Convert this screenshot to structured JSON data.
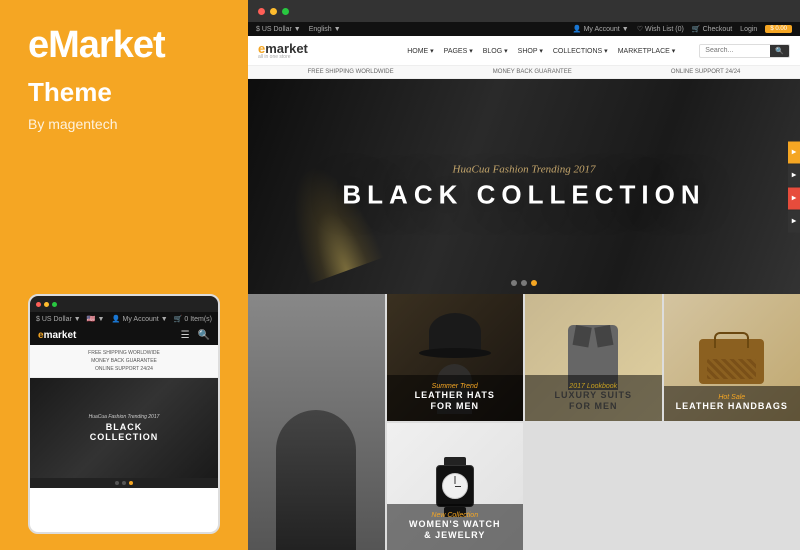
{
  "left_panel": {
    "brand": "eMarket",
    "theme_label": "Theme",
    "by_label": "By magentech"
  },
  "browser": {
    "dots": [
      "red",
      "yellow",
      "green"
    ]
  },
  "store": {
    "top_bar": {
      "currency": "$ US Dollar",
      "language": "English",
      "account": "My Account",
      "wishlist": "Wish List (0)",
      "checkout": "Checkout",
      "login": "Login",
      "register_label": "$ 0.00"
    },
    "logo": "market",
    "logo_prefix": "e",
    "logo_sub": "all in one store",
    "nav_links": [
      "HOME",
      "PAGES",
      "BLOG",
      "SHOP",
      "COLLECTIONS",
      "MARKETPLACE"
    ],
    "search_placeholder": "Search...",
    "info_strip": [
      "FREE SHIPPING WORLDWIDE",
      "MONEY BACK GUARANTEE",
      "ONLINE SUPPORT 24/24"
    ],
    "hero": {
      "script_text": "HuaCua Fashion Trending 2017",
      "main_text": "BLACK COLLECTION",
      "dots": [
        false,
        false,
        true
      ]
    },
    "products": [
      {
        "tag": "Summer Trend",
        "title": "LEATHER HATS\nFOR MEN",
        "bg": "hats"
      },
      {
        "tag": "",
        "title": "",
        "bg": "person"
      },
      {
        "tag": "2017 Lookbook",
        "title": "LUXURY SUITS\nFOR MEN",
        "bg": "suit",
        "highlight": true
      },
      {
        "tag": "Hot Sale",
        "title": "LEATHER HANDBAGS",
        "bg": "bag"
      },
      {
        "tag": "New Collection",
        "title": "WOMEN'S WATCH\n& JEWELRY",
        "bg": "watch"
      }
    ]
  },
  "mobile": {
    "currency": "$ US Dollar",
    "flag": "🇺🇸",
    "account": "My Account",
    "cart": "0 Item(s)",
    "logo": "market",
    "logo_prefix": "e",
    "info": [
      "FREE SHIPPING WORLDWIDE",
      "MONEY BACK GUARANTEE",
      "ONLINE SUPPORT 24/24"
    ],
    "hero_script": "HuaCua Fashion Trending 2017",
    "hero_main": "BLACK\nCOLLECTION",
    "dots": [
      false,
      false,
      true
    ]
  }
}
